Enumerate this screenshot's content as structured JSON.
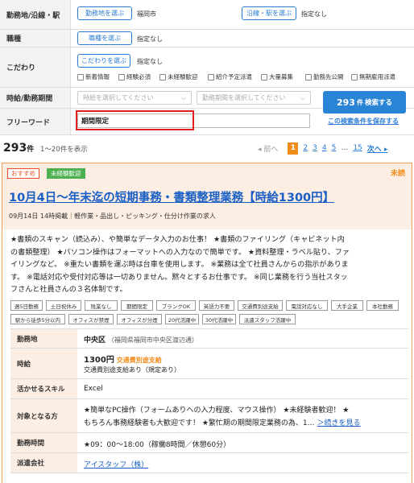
{
  "form": {
    "location": {
      "label": "勤務地/沿線・駅",
      "btn1": "勤務地を選ぶ",
      "value1": "福岡市",
      "btn2": "沿線・駅を選ぶ",
      "value2": "指定なし"
    },
    "category": {
      "label": "職種",
      "btn": "職種を選ぶ",
      "value": "指定なし"
    },
    "conditions": {
      "label": "こだわり",
      "btn": "こだわりを選ぶ",
      "value": "指定なし",
      "checks": [
        "新着情報",
        "経験必須",
        "未経験歓迎",
        "紹介予定派遣",
        "大量募集",
        "勤務先公開",
        "無期雇用派遣"
      ]
    },
    "period": {
      "label": "時給/勤務期間",
      "wage_placeholder": "時給を選択してください",
      "term_placeholder": "勤務期間を選択してください"
    },
    "freeword": {
      "label": "フリーワード",
      "value": "期間限定"
    },
    "search_button": {
      "count": "293",
      "unit": "件",
      "label": "検索する"
    },
    "save_link": "この検索条件を保存する"
  },
  "results": {
    "count": "293",
    "unit": "件",
    "range": "1〜20件を表示",
    "pager": {
      "prev": "◂ 前へ",
      "current": "1",
      "pages": [
        "2",
        "3",
        "4",
        "5"
      ],
      "dots": "…",
      "last": "15",
      "next": "次へ ▸"
    }
  },
  "job": {
    "badge_recommend": "おすすめ",
    "badge_new": "未経験歓迎",
    "unread": "未読",
    "title": "10月4日〜年末迄の短期事務・書類整理業務【時給1300円】",
    "meta": "09月14日 14時掲載｜軽作業・品出し・ピッキング・仕分け作業の求人",
    "desc_lines": [
      "★書類のスキャン（読込み）、や簡単なデータ入力のお仕事！ ★書類のファイリング（キャビネット内",
      "の書類整理） ★パソコン操作はフォーマットへの入力なので簡単です。 ★資料整理・ラベル貼り、ファ",
      "イリングなど。 ※重たい書類を運ぶ時は台車を使用します。 ※業務は全て社員さんからの指示がありま",
      "す。 ※電話対応や受付対応等は一切ありません。黙々とするお仕事です。 ※同じ業務を行う当社スタッ",
      "フさんと社員さんの３名体制です。"
    ],
    "tags": [
      "週5日勤務",
      "土日祝休み",
      "残業なし",
      "期間限定",
      "ブランクOK",
      "英語力不要",
      "交通費別途支給",
      "電話対応なし",
      "大手企業",
      "本社勤務",
      "駅から徒歩5分以内",
      "オフィスが禁煙",
      "オフィスが分煙",
      "20代活躍中",
      "30代活躍中",
      "派遣スタッフ活躍中"
    ],
    "info": {
      "location_label": "勤務地",
      "location_value": "中央区",
      "location_detail": "（福岡県福岡市中央区渡辺通）",
      "wage_label": "時給",
      "wage_value": "1300円",
      "wage_note": "交通費別途支給",
      "wage_sub": "交通費別途支給あり（規定あり）",
      "skill_label": "活かせるスキル",
      "skill_value": "Excel",
      "target_label": "対象となる方",
      "target_line1": "★簡単なPC操作（フォームありへの入力程度、マウス操作） ★未経験者歓迎！ ★",
      "target_line2": "もちろん事務経験者も大歓迎です！ ★繁忙期の期間限定業務の為、1…",
      "target_more": "＞続きを見る",
      "hours_label": "勤務時間",
      "hours_value": "★09：00〜18:00（稼働8時間／休憩60分）",
      "company_label": "派遣会社",
      "company_value": "アイスタッフ（株）"
    }
  }
}
